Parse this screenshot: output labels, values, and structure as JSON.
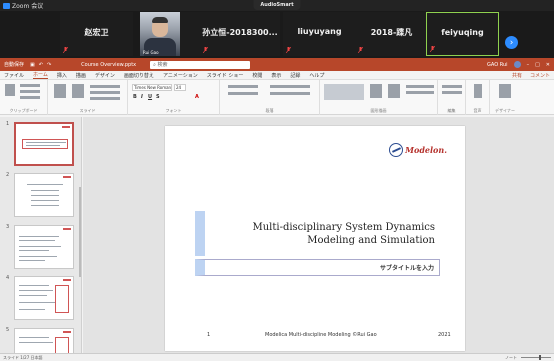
{
  "zoom": {
    "window_title": "Zoom 会议",
    "audio_badge": "AudioSmart",
    "participants": [
      {
        "name": "赵宏卫"
      },
      {
        "name": "Rui Gao",
        "has_video": true
      },
      {
        "name": "孙立恒-2018300..."
      },
      {
        "name": "liuyuyang"
      },
      {
        "name": "2018-蹀凡"
      },
      {
        "name": "feiyuqing",
        "active_speaker": true
      }
    ]
  },
  "powerpoint": {
    "autosave": "自動保存",
    "filename": "Course Overview.pptx",
    "search_placeholder": "検索",
    "user": "GAO Rui",
    "tabs": [
      "ファイル",
      "ホーム",
      "挿入",
      "描画",
      "デザイン",
      "画面切り替え",
      "アニメーション",
      "スライド ショー",
      "校閲",
      "表示",
      "記録",
      "ヘルプ"
    ],
    "active_tab": "ホーム",
    "share_label": "共有",
    "comment_label": "コメント",
    "ribbon": {
      "font_name": "Times New Roman",
      "font_size": "24",
      "groups": [
        "クリップボード",
        "スライド",
        "フォント",
        "段落",
        "図形描画",
        "編集",
        "音声",
        "デザイナー"
      ]
    },
    "slide_numbers": [
      "1",
      "2",
      "3",
      "4",
      "5"
    ],
    "slide": {
      "logo_text": "Modelon.",
      "title_line1": "Multi-disciplinary System Dynamics",
      "title_line2": "Modeling and Simulation",
      "subtitle": "サブタイトルを入力",
      "footer_num": "1",
      "footer_center": "Modelica Multi-discipline Modeling ©Rui Gao",
      "footer_year": "2021"
    },
    "status": {
      "left": "スライド 1/27  日本語",
      "right": "ノート"
    }
  },
  "colors": {
    "ppt_red": "#b7472a",
    "zoom_blue": "#2d8cff",
    "active_green": "#8fd14f"
  }
}
